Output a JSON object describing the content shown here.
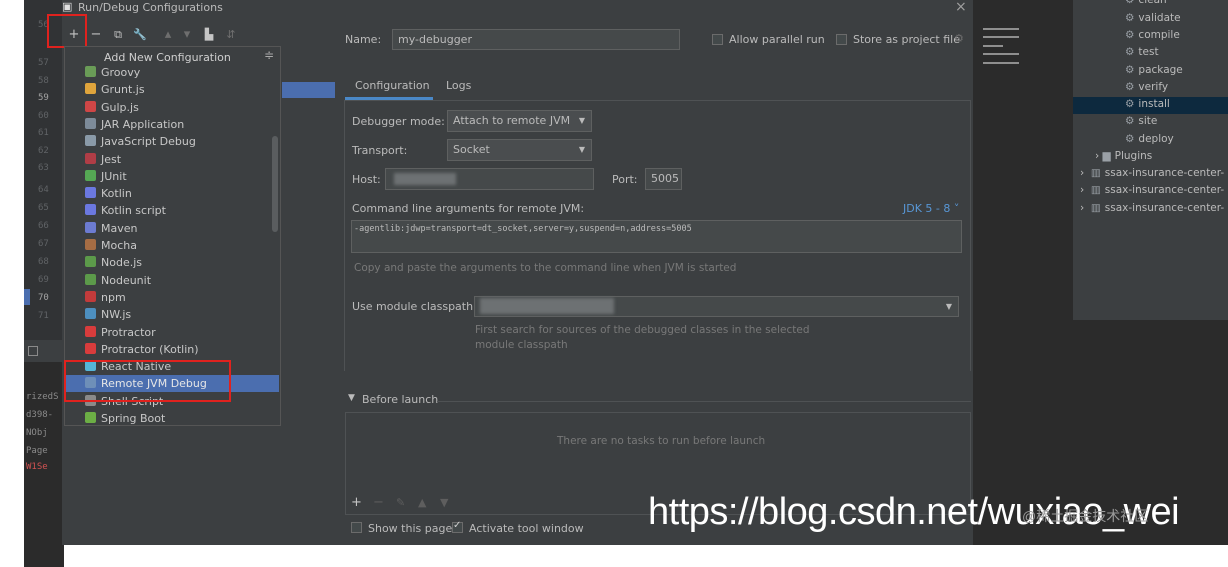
{
  "window": {
    "title": "Run/Debug Configurations",
    "close_glyph": "×"
  },
  "gutter": {
    "numbers": [
      "56",
      "57",
      "58",
      "59",
      "60",
      "61",
      "62",
      "63",
      "64",
      "65",
      "66",
      "67",
      "68",
      "69",
      "70",
      "71"
    ]
  },
  "ide_side_text": [
    "rizedS",
    "d398-",
    "NObj",
    "Page",
    "W1Se"
  ],
  "toolbar": {
    "add": "+",
    "remove": "−",
    "copy": "⧉",
    "edit": "🔧",
    "up": "▴",
    "down": "▾",
    "folder": "▙",
    "sort": "⇵"
  },
  "popup": {
    "title": "Add New Configuration",
    "pin_glyph": "≑",
    "items": [
      {
        "label": "Groovy",
        "color": "#6a9c57"
      },
      {
        "label": "Grunt.js",
        "color": "#e0a53c"
      },
      {
        "label": "Gulp.js",
        "color": "#cf4646"
      },
      {
        "label": "JAR Application",
        "color": "#7d8b99"
      },
      {
        "label": "JavaScript Debug",
        "color": "#8a9aa8"
      },
      {
        "label": "Jest",
        "color": "#b03d46"
      },
      {
        "label": "JUnit",
        "color": "#55a854"
      },
      {
        "label": "Kotlin",
        "color": "#6b78e0"
      },
      {
        "label": "Kotlin script",
        "color": "#6b78e0"
      },
      {
        "label": "Maven",
        "color": "#6c7bd1"
      },
      {
        "label": "Mocha",
        "color": "#a66d44"
      },
      {
        "label": "Node.js",
        "color": "#5c9a4a"
      },
      {
        "label": "Nodeunit",
        "color": "#5c9a4a"
      },
      {
        "label": "npm",
        "color": "#c23b3b"
      },
      {
        "label": "NW.js",
        "color": "#4d8fbf"
      },
      {
        "label": "Protractor",
        "color": "#d83c3c"
      },
      {
        "label": "Protractor (Kotlin)",
        "color": "#d83c3c"
      },
      {
        "label": "React Native",
        "color": "#55b6d8"
      },
      {
        "label": "Remote JVM Debug",
        "color": "#6e8fb8"
      },
      {
        "label": "Shell Script",
        "color": "#8a8a8a"
      },
      {
        "label": "Spring Boot",
        "color": "#6cae45"
      }
    ],
    "selected_index": 18
  },
  "config": {
    "name_label": "Name:",
    "name_value": "my-debugger",
    "allow_parallel": "Allow parallel run",
    "store_as_project": "Store as project file",
    "tabs": [
      "Configuration",
      "Logs"
    ],
    "debugger_mode_label": "Debugger mode:",
    "debugger_mode_value": "Attach to remote JVM",
    "transport_label": "Transport:",
    "transport_value": "Socket",
    "host_label": "Host:",
    "port_label": "Port:",
    "port_value": "5005",
    "cmd_label": "Command line arguments for remote JVM:",
    "jdk_select": "JDK 5 - 8",
    "cmd_value": "-agentlib:jdwp=transport=dt_socket,server=y,suspend=n,address=5005",
    "cmd_hint": "Copy and paste the arguments to the command line when JVM is started",
    "module_label": "Use module classpath:",
    "module_hint_1": "First search for sources of the debugged classes in the selected",
    "module_hint_2": "module classpath",
    "before_launch": "Before launch",
    "no_tasks": "There are no tasks to run before launch",
    "show_page": "Show this page",
    "activate_tool": "Activate tool window"
  },
  "maven": {
    "items": [
      "clean",
      "validate",
      "compile",
      "test",
      "package",
      "verify",
      "install",
      "site",
      "deploy"
    ],
    "plugins": "Plugins",
    "modules": [
      "ssax-insurance-center-",
      "ssax-insurance-center-",
      "ssax-insurance-center-"
    ],
    "selected": "install"
  },
  "watermark": {
    "url": "https://blog.csdn.net/wuxiao_wei",
    "small": "@稀土掘金技术社区"
  }
}
